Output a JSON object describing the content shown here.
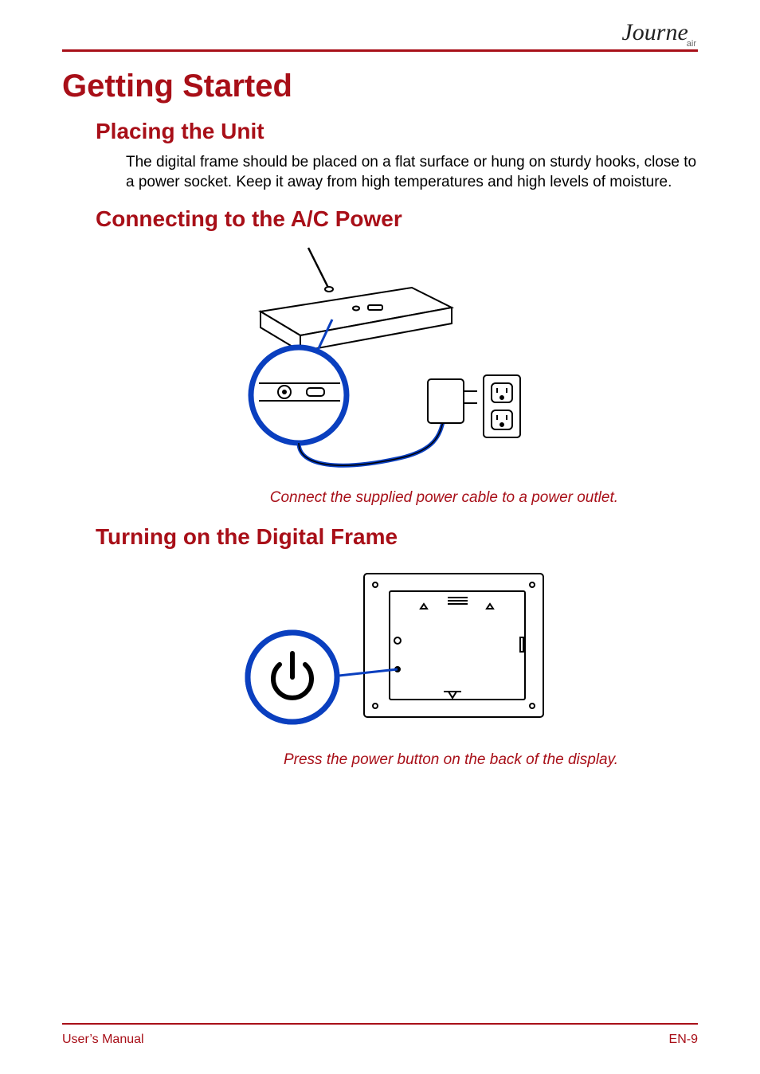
{
  "brand": {
    "name": "Journe",
    "sub": "air"
  },
  "chapter_title": "Getting Started",
  "sections": {
    "placing": {
      "title": "Placing the Unit",
      "body": "The digital frame should be placed on a flat surface or hung on sturdy hooks, close to a power socket. Keep it away from high temperatures and high levels of moisture."
    },
    "connecting": {
      "title": "Connecting to the A/C Power",
      "caption": "Connect the supplied power cable to a power outlet."
    },
    "turning_on": {
      "title": "Turning on the Digital Frame",
      "caption": "Press the power button on the back of the display."
    }
  },
  "footer": {
    "left": "User’s Manual",
    "right": "EN-9"
  }
}
